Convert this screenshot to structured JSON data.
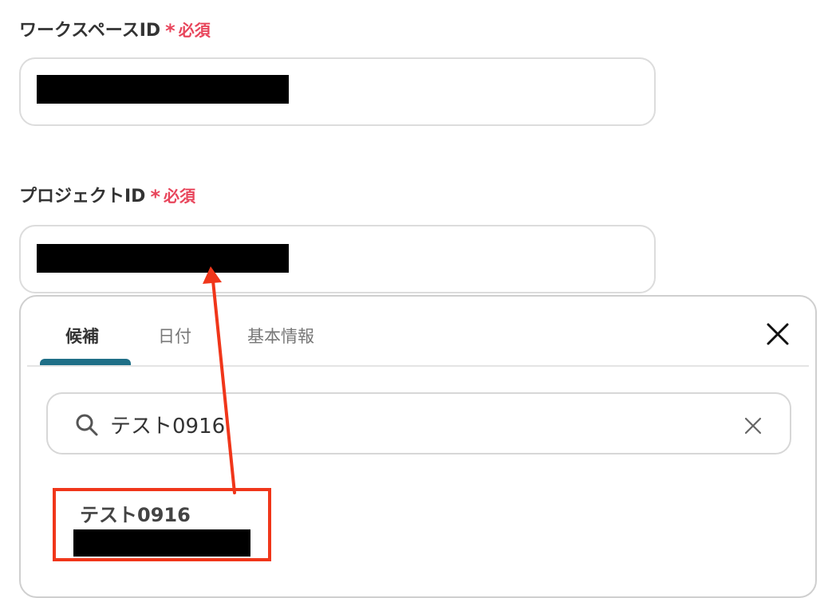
{
  "workspace_field": {
    "label": "ワークスペースID",
    "required_star": "*",
    "required_text": "必須",
    "value": ""
  },
  "project_field": {
    "label": "プロジェクトID",
    "required_star": "*",
    "required_text": "必須",
    "value": ""
  },
  "popup": {
    "tabs": [
      {
        "label": "候補",
        "active": true
      },
      {
        "label": "日付",
        "active": false
      },
      {
        "label": "基本情報",
        "active": false
      }
    ],
    "search": {
      "value": "テスト0916"
    },
    "options": [
      {
        "title": "テスト0916",
        "subtitle_redacted": true
      }
    ]
  },
  "colors": {
    "required": "#e8455b",
    "tab_indicator": "#1f6f87",
    "annotation": "#f0361a"
  }
}
